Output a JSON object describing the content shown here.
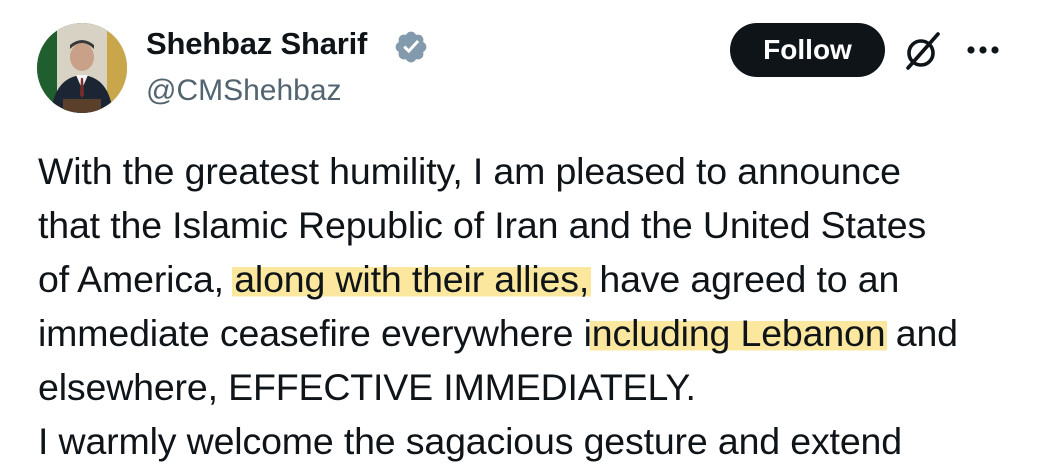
{
  "author": {
    "display_name": "Shehbaz Sharif",
    "handle": "@CMShehbaz",
    "verified": true,
    "verified_color": "#829aab"
  },
  "actions": {
    "follow_label": "Follow",
    "grok_icon": "grok-icon",
    "more_icon": "more-options-icon"
  },
  "tweet": {
    "lines": [
      {
        "segments": [
          {
            "text": "With the greatest humility, I am pleased to announce",
            "highlight": false
          }
        ]
      },
      {
        "segments": [
          {
            "text": "that the Islamic Republic of Iran and the United States",
            "highlight": false
          }
        ]
      },
      {
        "segments": [
          {
            "text": "of America, ",
            "highlight": false
          },
          {
            "text": "along with their allies,",
            "highlight": true
          },
          {
            "text": " have agreed to an",
            "highlight": false
          }
        ]
      },
      {
        "segments": [
          {
            "text": "immediate ceasefire everywhere i",
            "highlight": false
          },
          {
            "text": "ncluding Lebanon",
            "highlight": true
          },
          {
            "text": " and",
            "highlight": false
          }
        ]
      },
      {
        "segments": [
          {
            "text": "elsewhere, EFFECTIVE IMMEDIATELY.",
            "highlight": false
          }
        ]
      }
    ],
    "cut_off_line": "I warmly welcome the sagacious gesture and extend"
  },
  "colors": {
    "text": "#0f1419",
    "secondary_text": "#536471",
    "follow_bg": "#0f1419",
    "highlight": "#fade78"
  }
}
